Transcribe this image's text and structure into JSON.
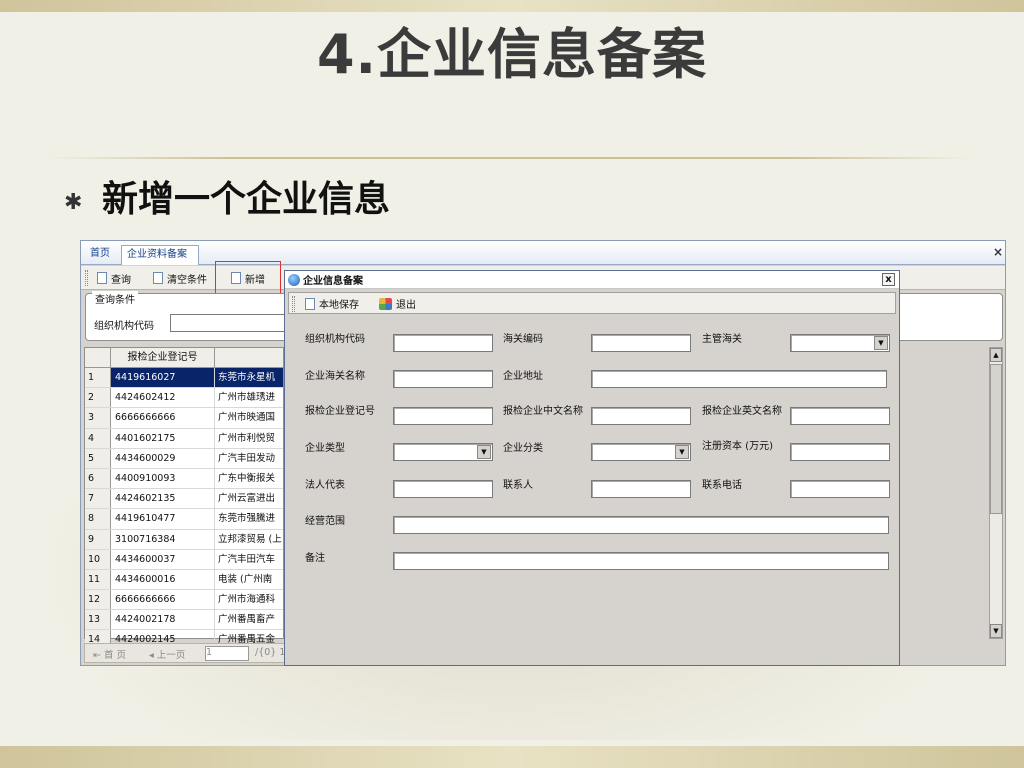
{
  "slide": {
    "title": "4.企业信息备案",
    "bullet": "新增一个企业信息",
    "bullet_symbol": "✱"
  },
  "app": {
    "tabs": [
      {
        "label": "首页"
      },
      {
        "label": "企业资料备案"
      }
    ],
    "close_symbol": "×",
    "toolbar": {
      "query": "查询",
      "clear": "清空条件",
      "add": "新增"
    },
    "query_panel": {
      "legend": "查询条件",
      "org_code_label": "组织机构代码",
      "org_code_value": ""
    },
    "grid": {
      "header": "报检企业登记号",
      "rows": [
        {
          "n": "1",
          "code": "4419616027",
          "name": "东莞市永星机"
        },
        {
          "n": "2",
          "code": "4424602412",
          "name": "广州市雄琇进"
        },
        {
          "n": "3",
          "code": "6666666666",
          "name": "广州市映通国"
        },
        {
          "n": "4",
          "code": "4401602175",
          "name": "广州市利悦贸"
        },
        {
          "n": "5",
          "code": "4434600029",
          "name": "广汽丰田发动"
        },
        {
          "n": "6",
          "code": "4400910093",
          "name": "广东中衡报关"
        },
        {
          "n": "7",
          "code": "4424602135",
          "name": "广州云富进出"
        },
        {
          "n": "8",
          "code": "4419610477",
          "name": "东莞市强騰进"
        },
        {
          "n": "9",
          "code": "3100716384",
          "name": "立邦漆贸易 (上"
        },
        {
          "n": "10",
          "code": "4434600037",
          "name": "广汽丰田汽车"
        },
        {
          "n": "11",
          "code": "4434600016",
          "name": "电装 (广州南"
        },
        {
          "n": "12",
          "code": "6666666666",
          "name": "广州市海通科"
        },
        {
          "n": "13",
          "code": "4424002178",
          "name": "广州番禺畜产"
        },
        {
          "n": "14",
          "code": "4424002145",
          "name": "广州番禺五金"
        }
      ]
    },
    "pager": {
      "first": "首 页",
      "prev": "上一页",
      "page_value": "1",
      "total": "/{0} 1"
    }
  },
  "dialog": {
    "title": "企业信息备案",
    "close": "x",
    "save": "本地保存",
    "exit": "退出",
    "fields": {
      "org_code": {
        "label": "组织机构代码",
        "value": ""
      },
      "customs_code": {
        "label": "海关编码",
        "value": ""
      },
      "supervising_customs": {
        "label": "主管海关",
        "value": ""
      },
      "customs_name": {
        "label": "企业海关名称",
        "value": ""
      },
      "address": {
        "label": "企业地址",
        "value": ""
      },
      "inspection_reg_no": {
        "label": "报检企业登记号",
        "value": ""
      },
      "inspection_cn_name": {
        "label": "报检企业中文名称",
        "value": ""
      },
      "inspection_en_name": {
        "label": "报检企业英文名称",
        "value": ""
      },
      "company_type": {
        "label": "企业类型",
        "value": ""
      },
      "company_category": {
        "label": "企业分类",
        "value": ""
      },
      "registered_capital": {
        "label": "注册资本 (万元)",
        "value": ""
      },
      "legal_rep": {
        "label": "法人代表",
        "value": ""
      },
      "contact": {
        "label": "联系人",
        "value": ""
      },
      "phone": {
        "label": "联系电话",
        "value": ""
      },
      "business_scope": {
        "label": "经营范围",
        "value": ""
      },
      "remarks": {
        "label": "备注",
        "value": ""
      }
    }
  }
}
